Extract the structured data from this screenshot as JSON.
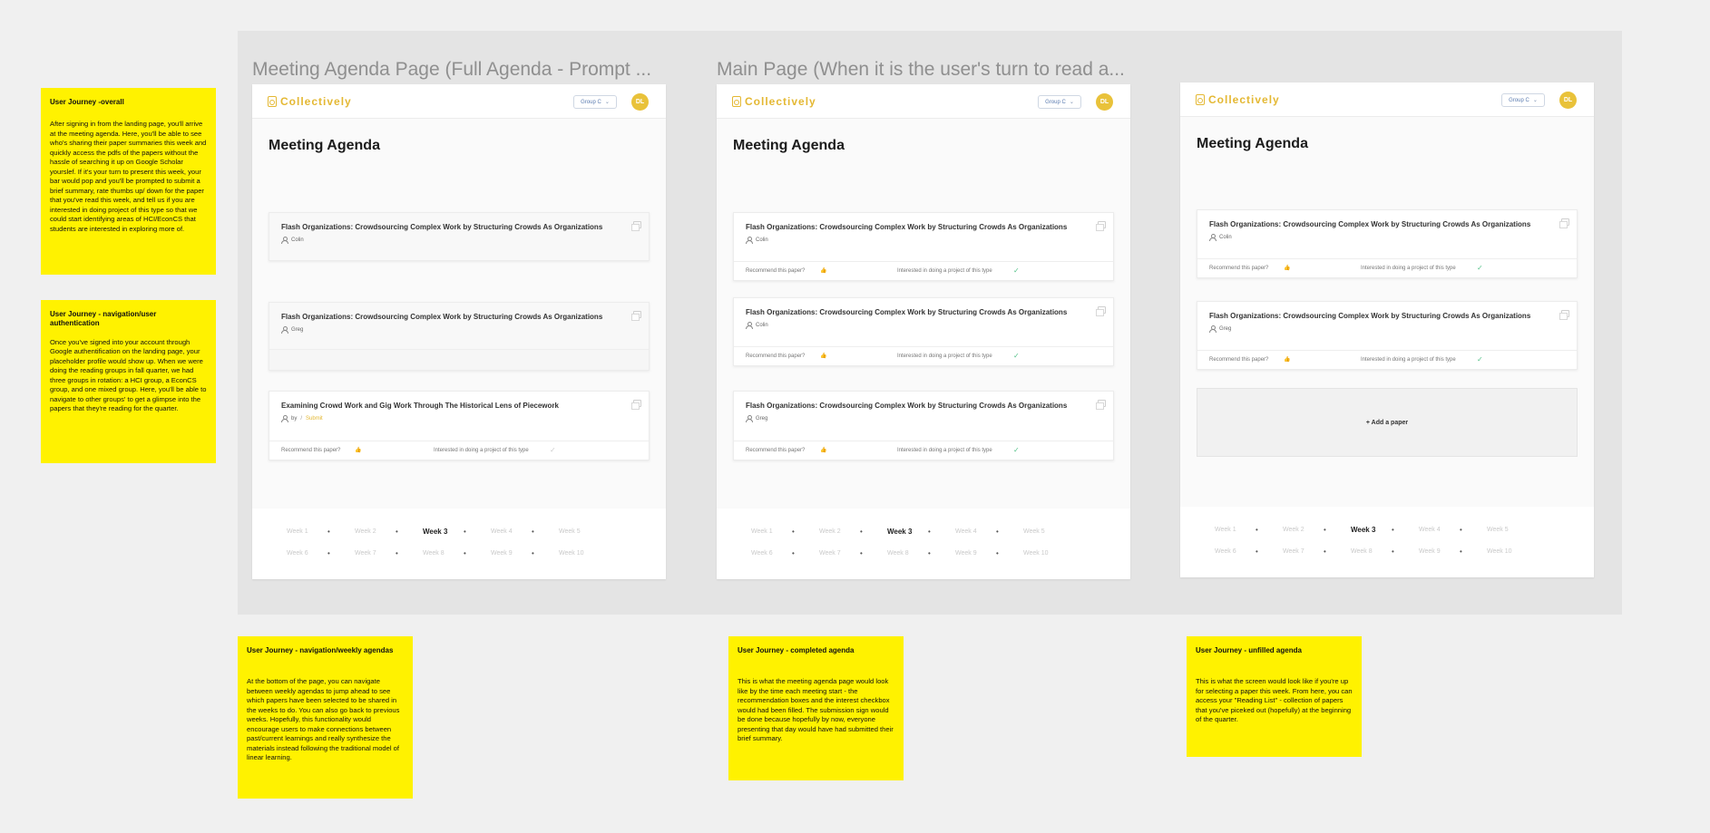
{
  "frames": [
    {
      "title": "Meeting Agenda Page (Full Agenda - Prompt ...",
      "app_name": "Collectively",
      "group": "Group C",
      "avatar": "DL",
      "page_title": "Meeting Agenda",
      "cards": [
        {
          "title": "Flash Organizations: Crowdsourcing Complex Work by Structuring Crowds As Organizations",
          "author": "Colin"
        },
        {
          "title": "Flash Organizations: Crowdsourcing Complex Work by Structuring Crowds As Organizations",
          "author": "Greg"
        },
        {
          "title": "Examining Crowd Work and Gig Work Through The Historical Lens of Piecework",
          "author": "by",
          "separator": "/",
          "submit": "Submit",
          "recommend": "Recommend this paper?",
          "interest": "Interested in doing a project of this type"
        }
      ]
    },
    {
      "title": "Main Page (When it is the user's turn to read a...",
      "app_name": "Collectively",
      "group": "Group C",
      "avatar": "DL",
      "page_title": "Meeting Agenda",
      "cards": [
        {
          "title": "Flash Organizations: Crowdsourcing Complex Work by Structuring Crowds As Organizations",
          "author": "Colin",
          "recommend": "Recommend this paper?",
          "interest": "Interested in doing a project of this type"
        },
        {
          "title": "Flash Organizations: Crowdsourcing Complex Work by Structuring Crowds As Organizations",
          "author": "Colin",
          "recommend": "Recommend this paper?",
          "interest": "Interested in doing a project of this type"
        },
        {
          "title": "Flash Organizations: Crowdsourcing Complex Work by Structuring Crowds As Organizations",
          "author": "Greg",
          "recommend": "Recommend this paper?",
          "interest": "Interested in doing a project of this type"
        }
      ]
    },
    {
      "title": "",
      "app_name": "Collectively",
      "group": "Group C",
      "avatar": "DL",
      "page_title": "Meeting Agenda",
      "cards": [
        {
          "title": "Flash Organizations: Crowdsourcing Complex Work by Structuring Crowds As Organizations",
          "author": "Colin",
          "recommend": "Recommend this paper?",
          "interest": "Interested in doing a project of this type"
        },
        {
          "title": "Flash Organizations: Crowdsourcing Complex Work by Structuring Crowds As Organizations",
          "author": "Greg",
          "recommend": "Recommend this paper?",
          "interest": "Interested in doing a project of this type"
        }
      ],
      "add_paper": "+ Add a paper"
    }
  ],
  "weeks_row1": [
    "Week 1",
    "Week 2",
    "Week 3",
    "Week 4",
    "Week 5"
  ],
  "weeks_row2": [
    "Week 6",
    "Week 7",
    "Week 8",
    "Week 9",
    "Week 10"
  ],
  "active_week": "Week 3",
  "dot": "•",
  "thumbs_glyph": "👍",
  "check_glyph": "✓",
  "chevron_glyph": "⌄",
  "stickies": {
    "overall": {
      "title": "User Journey -overall",
      "body": "After signing in from the landing page, you'll arrive at the meeting agenda. Here, you'll be able to see who's sharing their paper summaries this week and quickly access the pdfs of the papers without the hassle of searching it up on Google Scholar yourslef. If it's your turn to present this week, your bar would pop and you'll be prompted to submit a brief summary, rate thumbs up/ down for the paper that you've read this week, and tell us if you are interested in doing project of this type so that we could start identifying areas of HCI/EconCS that students are interested in exploring more of."
    },
    "auth": {
      "title": "User Journey - navigation/user authentication",
      "body": "Once you've signed into your account through Google authentification on the landing page, your placeholder profile would show up. When we were doing the reading groups in fall quarter, we had three groups in rotation: a HCI group, a EconCS group, and one mixed group. Here, you'll be able to navigate to other groups' to get a glimpse into the papers that they're reading for the quarter."
    },
    "weekly": {
      "title": "User Journey - navigation/weekly agendas",
      "body": "At the bottom of the page, you can navigate between weekly agendas to jump ahead to see which papers have been selected to be shared in the weeks to do. You can also go back to previous weeks. Hopefully, this functionality would encourage users to make connections between past/current learnings and really synthesize the materials instead following the traditional model of linear learning."
    },
    "completed": {
      "title": "User Journey - completed agenda",
      "body": "This is what the meeting agenda page would look like by the time each meeting start - the recommendation boxes and the interest checkbox would had been filled. The submission sign would be done because hopefully by now, everyone presenting that day would have had submitted their brief summary."
    },
    "unfilled": {
      "title": "User Journey - unfilled agenda",
      "body": "This is what the screen would look like if you're up for selecting a paper this week. From here, you can access your \"Reading List\" - collection of papers that you've piceked out (hopefully) at the beginning of the quarter."
    }
  }
}
